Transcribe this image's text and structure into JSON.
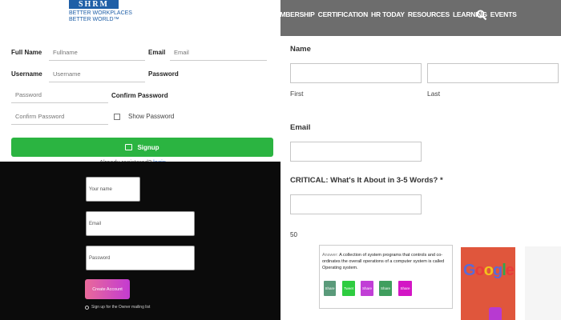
{
  "header": {
    "logo_mark": "SHRM",
    "logo_tagline": "BETTER WORKPLACES BETTER WORLD™",
    "nav": [
      "MEMBERSHIP",
      "CERTIFICATION",
      "HR TODAY",
      "RESOURCES",
      "LEARNING",
      "EVENTS"
    ],
    "search_icon": "search-icon",
    "bar_color": "#6d6d6d"
  },
  "signup_form": {
    "full_name_label": "Full Name",
    "full_name_placeholder": "Fullname",
    "email_label": "Email",
    "email_placeholder": "Email",
    "username_label": "Username",
    "username_placeholder": "Username",
    "password_label": "Password",
    "password_placeholder": "Password",
    "confirm_password_label": "Confirm Password",
    "confirm_password_placeholder": "Confirm Password",
    "show_password_label": "Show Password",
    "signup_button": "Signup",
    "already_text": "Already registered?",
    "login_link": "login",
    "button_color": "#2bb441"
  },
  "dark_form": {
    "name_placeholder": "Your name",
    "email_placeholder": "Email",
    "password_placeholder": "Password",
    "create_button": "Create Account",
    "mailing_list_label": "Sign up for the Owner mailing list"
  },
  "contact_form": {
    "name_label": "Name",
    "first_label": "First",
    "last_label": "Last",
    "email_label": "Email",
    "critical_label": "CRITICAL: What's It About in 3-5 Words? *",
    "counter": "50"
  },
  "answer_card": {
    "answer_prefix": "Answer:",
    "answer_text": "A collection of system programs that controls and co-ordinates the overall operations of a computer system is called Operating system.",
    "share_buttons": [
      "Share",
      "Tweet",
      "Share",
      "Share",
      "Share"
    ],
    "share_colors": [
      "#5a9a7a",
      "#2ecc40",
      "#c13fd6",
      "#3f9e5e",
      "#d316c5"
    ]
  },
  "google_thumb": {
    "text": "Google"
  }
}
